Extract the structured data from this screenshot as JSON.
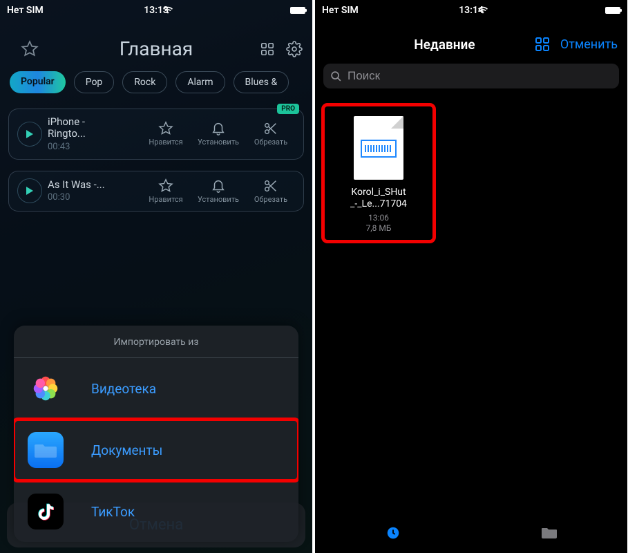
{
  "left": {
    "status": {
      "carrier": "Нет SIM",
      "time": "13:13"
    },
    "header": {
      "title": "Главная"
    },
    "chips": [
      "Popular",
      "Pop",
      "Rock",
      "Alarm",
      "Blues &"
    ],
    "songs": [
      {
        "title": "iPhone - Ringto...",
        "time": "00:43",
        "pro": "PRO",
        "like": "Нравится",
        "set": "Установить",
        "cut": "Обрезать"
      },
      {
        "title": "As It Was -...",
        "time": "00:30",
        "like": "Нравится",
        "set": "Установить",
        "cut": "Обрезать"
      }
    ],
    "sheet": {
      "head": "Импортировать из",
      "rows": [
        {
          "label": "Видеотека"
        },
        {
          "label": "Документы"
        },
        {
          "label": "ТикТок"
        }
      ],
      "cancel": "Отмена"
    }
  },
  "right": {
    "status": {
      "carrier": "Нет SIM",
      "time": "13:14"
    },
    "header": {
      "title": "Недавние",
      "cancel": "Отменить"
    },
    "search": {
      "placeholder": "Поиск"
    },
    "file": {
      "name_l1": "Korol_i_SHut",
      "name_l2": "_-_Le...71704",
      "time": "13:06",
      "size": "7,8 МБ"
    }
  }
}
